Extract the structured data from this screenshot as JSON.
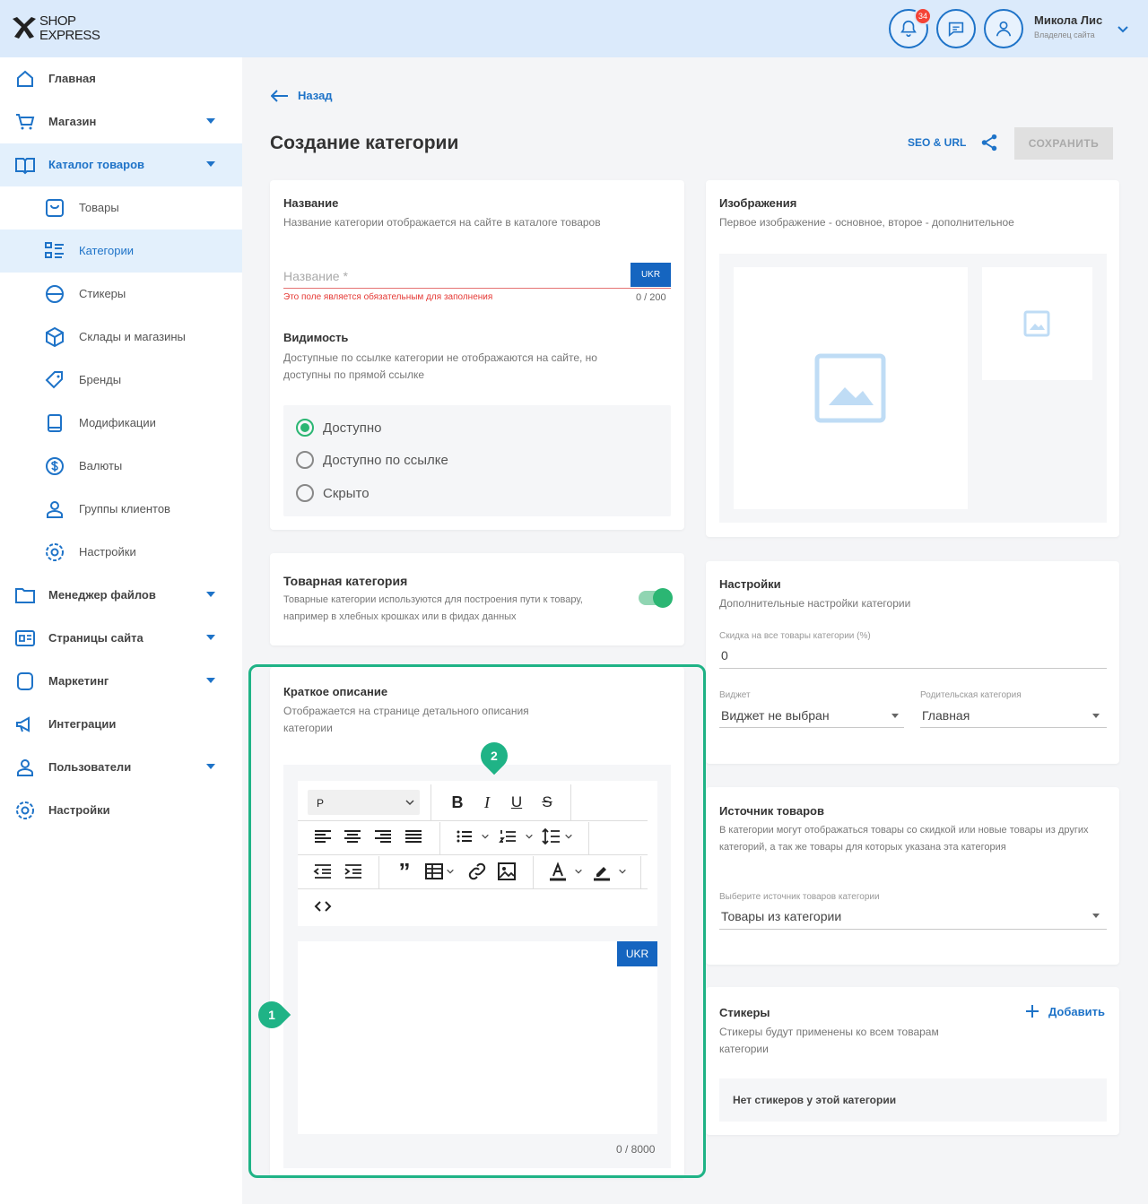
{
  "header": {
    "logo_line1": "SHOP",
    "logo_line2": "EXPRESS",
    "notifications_count": "34",
    "user_name": "Микола Лис",
    "user_role": "Владелец сайта"
  },
  "sidebar": {
    "items": [
      {
        "label": "Главная",
        "icon": "home-icon"
      },
      {
        "label": "Магазин",
        "icon": "cart-icon"
      },
      {
        "label": "Каталог товаров",
        "icon": "catalog-icon"
      },
      {
        "label": "Товары",
        "icon": "products-icon"
      },
      {
        "label": "Категории",
        "icon": "categories-icon"
      },
      {
        "label": "Стикеры",
        "icon": "stickers-icon"
      },
      {
        "label": "Склады и магазины",
        "icon": "warehouse-icon"
      },
      {
        "label": "Бренды",
        "icon": "brands-icon"
      },
      {
        "label": "Модификации",
        "icon": "modifications-icon"
      },
      {
        "label": "Валюты",
        "icon": "currency-icon"
      },
      {
        "label": "Группы клиентов",
        "icon": "client-groups-icon"
      },
      {
        "label": "Настройки",
        "icon": "settings-icon"
      },
      {
        "label": "Менеджер файлов",
        "icon": "folder-icon"
      },
      {
        "label": "Страницы сайта",
        "icon": "pages-icon"
      },
      {
        "label": "Маркетинг",
        "icon": "marketing-icon"
      },
      {
        "label": "Интеграции",
        "icon": "integrations-icon"
      },
      {
        "label": "Пользователи",
        "icon": "users-icon"
      },
      {
        "label": "Настройки",
        "icon": "gear-icon"
      }
    ]
  },
  "page": {
    "back": "Назад",
    "title": "Создание категории",
    "seo_link": "SEO & URL",
    "save": "СОХРАНИТЬ"
  },
  "name_card": {
    "title": "Название",
    "subtitle": "Название категории отображается на сайте в каталоге товаров",
    "placeholder": "Название *",
    "lang": "UKR",
    "error": "Это поле является обязательным для заполнения",
    "counter": "0 / 200",
    "visibility_title": "Видимость",
    "visibility_sub": "Доступные по ссылке категории не отображаются на сайте, но доступны по прямой ссылке",
    "options": [
      "Доступно",
      "Доступно по ссылке",
      "Скрыто"
    ],
    "selected_option": "Доступно"
  },
  "product_category": {
    "title": "Товарная категория",
    "subtitle": "Товарные категории используются для построения пути к товару, например в хлебных крошках или в фидах данных",
    "enabled": true
  },
  "short_description": {
    "title": "Краткое описание",
    "subtitle": "Отображается на странице детального описания категории",
    "format": "P",
    "lang": "UKR",
    "counter": "0 / 8000"
  },
  "images": {
    "title": "Изображения",
    "subtitle": "Первое изображение - основное, второе - дополнительное"
  },
  "settings": {
    "title": "Настройки",
    "subtitle": "Дополнительные настройки категории",
    "discount_label": "Скидка на все товары категории (%)",
    "discount_value": "0",
    "widget_label": "Виджет",
    "widget_value": "Виджет не выбран",
    "parent_label": "Родительская категория",
    "parent_value": "Главная"
  },
  "source": {
    "title": "Источник товаров",
    "subtitle": "В категории могут отображаться товары со скидкой или новые товары из других категорий, а так же товары для которых указана эта категория",
    "select_label": "Выберите источник товаров категории",
    "select_value": "Товары из категории"
  },
  "stickers": {
    "title": "Стикеры",
    "subtitle": "Стикеры будут применены ко всем товарам категории",
    "add": "Добавить",
    "empty": "Нет стикеров у этой категории"
  },
  "markers": {
    "one": "1",
    "two": "2"
  },
  "colors": {
    "accent": "#1e73c8",
    "highlight": "#1fb386",
    "header_bg": "#dbeafb"
  }
}
